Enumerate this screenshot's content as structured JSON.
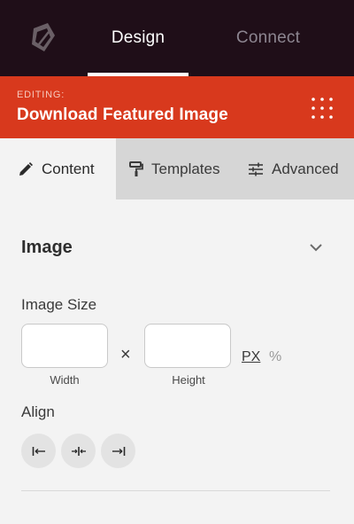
{
  "nav": {
    "design_label": "Design",
    "connect_label": "Connect"
  },
  "editing": {
    "label": "EDITING:",
    "title": "Download Featured Image"
  },
  "tabs": [
    {
      "label": "Content",
      "icon": "pencil-icon",
      "active": true
    },
    {
      "label": "Templates",
      "icon": "paint-roller-icon",
      "active": false
    },
    {
      "label": "Advanced",
      "icon": "sliders-icon",
      "active": false
    }
  ],
  "section": {
    "title": "Image",
    "image_size_label": "Image Size",
    "width_value": "",
    "height_value": "",
    "width_label": "Width",
    "height_label": "Height",
    "times_symbol": "×",
    "unit_px": "PX",
    "unit_percent": "%",
    "align_label": "Align",
    "align_options": [
      "left",
      "center",
      "right"
    ]
  },
  "colors": {
    "nav_bg": "#1f0e18",
    "accent": "#d8391d"
  }
}
